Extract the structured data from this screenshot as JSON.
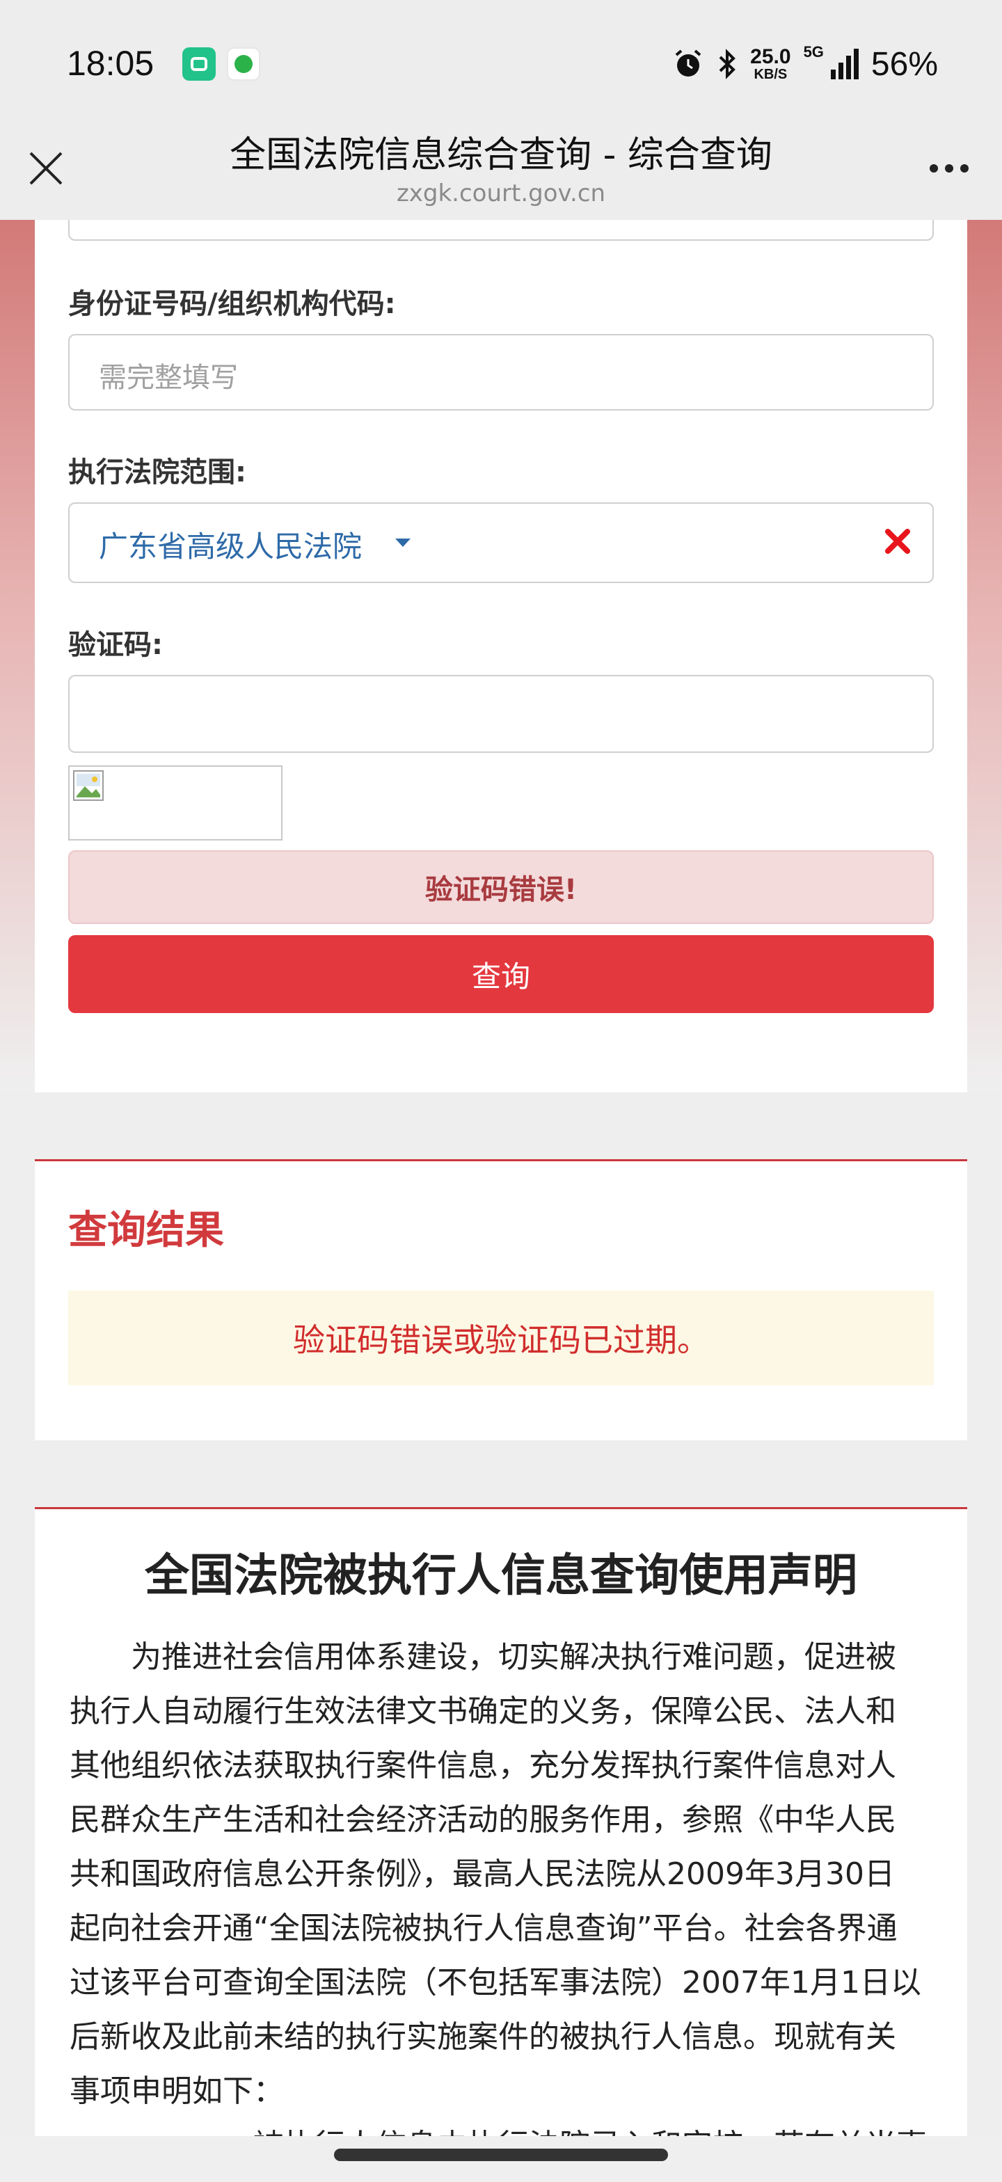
{
  "status_bar": {
    "time": "18:05",
    "net_speed_value": "25.0",
    "net_speed_unit": "KB/S",
    "network": "5G",
    "battery": "56%",
    "icons": [
      "alarm-icon",
      "bluetooth-icon",
      "signal-icon"
    ]
  },
  "browser": {
    "title": "全国法院信息综合查询 - 综合查询",
    "url": "zxgk.court.gov.cn"
  },
  "form": {
    "id_label": "身份证号码/组织机构代码:",
    "id_placeholder": "需完整填写",
    "court_label": "执行法院范围:",
    "court_value": "广东省高级人民法院",
    "captcha_label": "验证码:",
    "captcha_value": "",
    "alert": "验证码错误!",
    "submit": "查询"
  },
  "result": {
    "title": "查询结果",
    "message": "验证码错误或验证码已过期。"
  },
  "declaration": {
    "title": "全国法院被执行人信息查询使用声明",
    "lines": [
      "为推进社会信用体系建设，切实解决执行难问题，促进被",
      "执行人自动履行生效法律文书确定的义务，保障公民、法人和",
      "其他组织依法获取执行案件信息，充分发挥执行案件信息对人",
      "民群众生产生活和社会经济活动的服务作用，参照《中华人民",
      "共和国政府信息公开条例》，最高人民法院从2009年3月30日",
      "起向社会开通“全国法院被执行人信息查询”平台。社会各界通",
      "过该平台可查询全国法院（不包括军事法院）2007年1月1日以",
      "后新收及此前未结的执行实施案件的被执行人信息。现就有关",
      "事项申明如下：",
      "一、被执行人信息由执行法院录入和审核，若有关当事人"
    ]
  },
  "colors": {
    "primary_red": "#e4383f",
    "link_blue": "#2e6aa8",
    "notice_bg": "#fdf8e5"
  }
}
